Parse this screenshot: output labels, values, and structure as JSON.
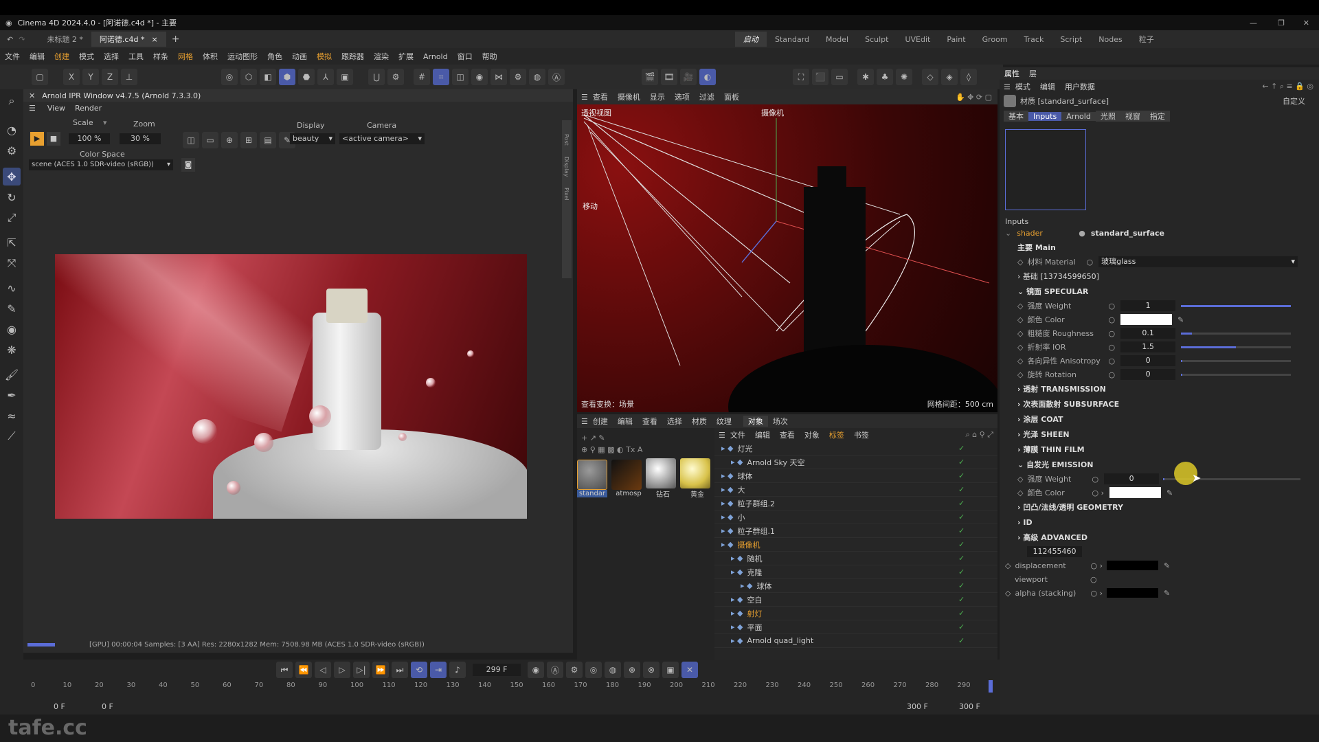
{
  "window": {
    "title": "Cinema 4D 2024.4.0 - [阿诺德.c4d *] - 主要"
  },
  "doc_tabs": [
    "未标题 2 *",
    "阿诺德.c4d *"
  ],
  "layouts": [
    "启动",
    "Standard",
    "Model",
    "Sculpt",
    "UVEdit",
    "Paint",
    "Groom",
    "Track",
    "Script",
    "Nodes",
    "粒子"
  ],
  "menu": [
    "文件",
    "编辑",
    "创建",
    "模式",
    "选择",
    "工具",
    "样条",
    "网格",
    "体积",
    "运动图形",
    "角色",
    "动画",
    "模拟",
    "跟踪器",
    "渲染",
    "扩展",
    "Arnold",
    "窗口",
    "帮助"
  ],
  "ipr": {
    "title": "Arnold IPR Window v4.7.5 (Arnold 7.3.3.0)",
    "menu": [
      "View",
      "Render"
    ],
    "scale_label": "Scale",
    "zoom_label": "Zoom",
    "display_label": "Display",
    "camera_label": "Camera",
    "scale": "100 %",
    "zoom": "30 %",
    "display": "beauty",
    "camera": "<active camera>",
    "colorspace_label": "Color Space",
    "colorspace": "scene (ACES 1.0 SDR-video (sRGB))",
    "status": "[GPU] 00:00:04  Samples: [3 AA]  Res: 2280x1282  Mem: 7508.98 MB  (ACES 1.0 SDR-video (sRGB))",
    "side_tabs": [
      "Post",
      "Display",
      "Pixel"
    ]
  },
  "viewport": {
    "menu": [
      "查看",
      "摄像机",
      "显示",
      "选项",
      "过滤",
      "面板"
    ],
    "label_tl": "透视视图",
    "label_cam": "摄像机",
    "label_move": "移动",
    "footer_left": "查看变换：场景",
    "footer_right": "网格间距：500 cm"
  },
  "materials": {
    "menu": [
      "创建",
      "编辑",
      "查看",
      "选择",
      "材质",
      "纹理"
    ],
    "items": [
      {
        "name": "standar",
        "color": "#6b6b6b"
      },
      {
        "name": "atmosp",
        "color": "#4a2a10"
      },
      {
        "name": "钻石",
        "color": "#bfbfbf"
      },
      {
        "name": "黄金",
        "color": "#d8c24a"
      }
    ]
  },
  "objects": {
    "tabs": [
      "对象",
      "场次"
    ],
    "menu": [
      "文件",
      "编辑",
      "查看",
      "对象",
      "标签",
      "书签"
    ],
    "rows": [
      {
        "name": "灯光",
        "indent": 0
      },
      {
        "name": "Arnold Sky 天空",
        "indent": 1
      },
      {
        "name": "球体",
        "indent": 0
      },
      {
        "name": "大",
        "indent": 0
      },
      {
        "name": "粒子群组.2",
        "indent": 0
      },
      {
        "name": "小",
        "indent": 0
      },
      {
        "name": "粒子群组.1",
        "indent": 0
      },
      {
        "name": "摄像机",
        "indent": 0
      },
      {
        "name": "随机",
        "indent": 1
      },
      {
        "name": "克隆",
        "indent": 1
      },
      {
        "name": "球体",
        "indent": 2
      },
      {
        "name": "空白",
        "indent": 1
      },
      {
        "name": "射灯",
        "indent": 1
      },
      {
        "name": "平面",
        "indent": 1
      },
      {
        "name": "Arnold quad_light",
        "indent": 1
      }
    ]
  },
  "attributes": {
    "tabs": [
      "属性",
      "层"
    ],
    "menu": [
      "模式",
      "编辑",
      "用户数据"
    ],
    "material": "材质 [standard_surface]",
    "custom": "自定义",
    "subtabs": [
      "基本",
      "Inputs",
      "Arnold",
      "光照",
      "视窗",
      "指定"
    ],
    "inputs_label": "Inputs",
    "shader_label": "shader",
    "shader_value": "standard_surface",
    "main_label": "主要 Main",
    "material_label": "材料 Material",
    "material_value": "玻璃glass",
    "base_label": "基础 [13734599650]",
    "specular_label": "镜面 SPECULAR",
    "spec": [
      {
        "label": "强度 Weight",
        "value": "1",
        "fill": 1.0
      },
      {
        "label": "颜色 Color",
        "value": "",
        "fill": null
      },
      {
        "label": "粗糙度 Roughness",
        "value": "0.1",
        "fill": 0.1
      },
      {
        "label": "折射率 IOR",
        "value": "1.5",
        "fill": 0.5
      },
      {
        "label": "各向异性 Anisotropy",
        "value": "0",
        "fill": 0
      },
      {
        "label": "旋转 Rotation",
        "value": "0",
        "fill": 0
      }
    ],
    "sections": [
      "透射 TRANSMISSION",
      "次表面散射 SUBSURFACE",
      "涂层 COAT",
      "光泽 SHEEN",
      "薄膜 THIN FILM"
    ],
    "emission_label": "自发光 EMISSION",
    "emission": [
      {
        "label": "强度 Weight",
        "value": "0"
      },
      {
        "label": "颜色 Color",
        "value": ""
      }
    ],
    "sections2": [
      "凹凸/法线/透明 GEOMETRY",
      "ID",
      "高级 ADVANCED"
    ],
    "id_value": "112455460",
    "extra": [
      {
        "label": "displacement"
      },
      {
        "label": "viewport"
      },
      {
        "label": "alpha (stacking)"
      }
    ]
  },
  "timeline": {
    "frame": "299 F",
    "ticks": [
      "0",
      "10",
      "20",
      "30",
      "40",
      "50",
      "60",
      "70",
      "80",
      "90",
      "100",
      "110",
      "120",
      "130",
      "140",
      "150",
      "160",
      "170",
      "180",
      "190",
      "200",
      "210",
      "220",
      "230",
      "240",
      "250",
      "260",
      "270",
      "280",
      "290"
    ],
    "start": "0 F",
    "start2": "0 F",
    "end": "300 F",
    "end2": "300 F"
  },
  "watermark": "tafe.cc",
  "colors": {
    "accent": "#5b6dd8",
    "orange": "#e8a030",
    "green": "#4caf50"
  }
}
